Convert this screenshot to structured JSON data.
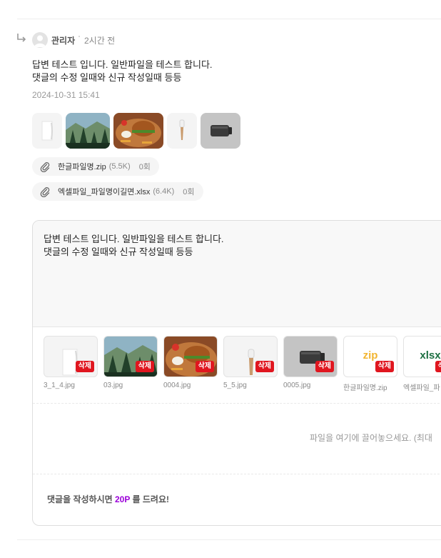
{
  "reply": {
    "author": "관리자",
    "time_ago": "2시간 전",
    "body_line1": "답변 테스트 입니다. 일반파일을 테스트 합니다.",
    "body_line2": "댓글의 수정 일때와 신규 작성일때 등등",
    "date": "2024-10-31 15:41",
    "images": [
      "vase-white",
      "mountain-forest",
      "burger-plate",
      "wooden-dropper",
      "dark-bottle"
    ],
    "files": [
      {
        "name": "한글파일명.zip",
        "size": "(5.5K)",
        "count": "0회"
      },
      {
        "name": "엑셀파일_파일명이길면.xlsx",
        "size": "(6.4K)",
        "count": "0회"
      }
    ]
  },
  "editor": {
    "text_line1": "답변 테스트 입니다. 일반파일을 테스트 합니다.",
    "text_line2": "댓글의 수정 일때와 신규 작성일때 등등",
    "delete_label": "삭제",
    "uploads": [
      {
        "name": "3_1_4.jpg",
        "kind": "vase-white"
      },
      {
        "name": "03.jpg",
        "kind": "mountain-forest"
      },
      {
        "name": "0004.jpg",
        "kind": "burger-plate"
      },
      {
        "name": "5_5.jpg",
        "kind": "wooden-dropper"
      },
      {
        "name": "0005.jpg",
        "kind": "dark-bottle"
      },
      {
        "name": "한글파일명.zip",
        "kind": "zip",
        "ext": "zip"
      },
      {
        "name": "엑셀파일_파",
        "kind": "xlsx",
        "ext": "xlsx"
      }
    ],
    "drop_text": "파일을 여기에 끌어놓으세요. (최대",
    "reward_prefix": "댓글을 작성하시면",
    "reward_points": "20P",
    "reward_suffix": "를 드려요!"
  },
  "colors": {
    "delete_badge": "#e0161f",
    "points": "#9b00d9",
    "zip": "#f2b531",
    "xlsx": "#1d6f42"
  }
}
